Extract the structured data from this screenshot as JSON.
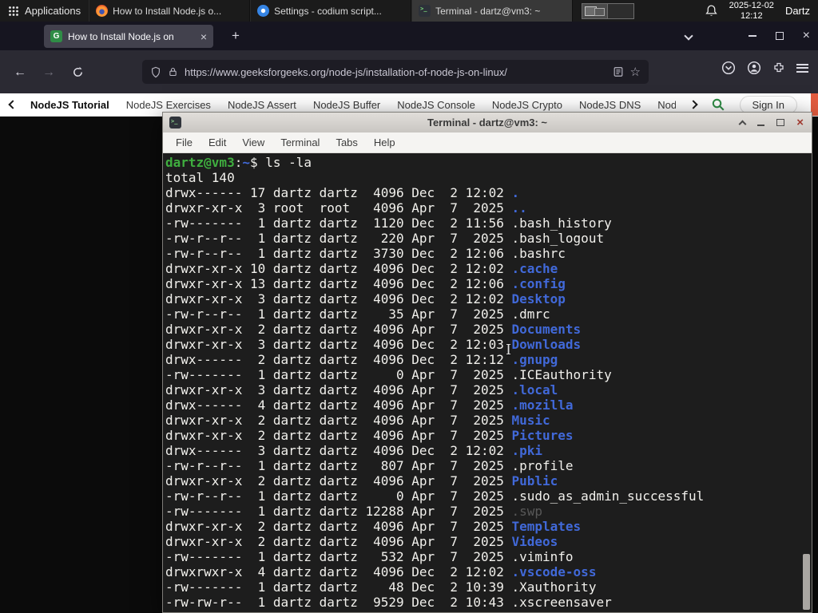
{
  "colors": {
    "gfg_green": "#2f8d46",
    "nav_accent_strip": "#e25c3f",
    "terminal_prompt_green": "#3fae3f",
    "terminal_dir_blue": "#4169d9",
    "terminal_background": "#1d1d1d"
  },
  "panel": {
    "applications_label": "Applications",
    "windows": [
      {
        "title": "How to Install Node.js o...",
        "icon": "firefox",
        "active": false
      },
      {
        "title": "Settings - codium script...",
        "icon": "settings",
        "active": false
      },
      {
        "title": "Terminal - dartz@vm3: ~",
        "icon": "terminal",
        "active": true
      }
    ],
    "clock": {
      "date": "2025-12-02",
      "time": "12:12"
    },
    "user": "Dartz"
  },
  "browser": {
    "tab_title": "How to Install Node.js on",
    "tab_favicon_letter": "G",
    "new_tab_label": "+",
    "url": "https://www.geeksforgeeks.org/node-js/installation-of-node-js-on-linux/",
    "site_nav": {
      "items": [
        "NodeJS Tutorial",
        "NodeJS Exercises",
        "NodeJS Assert",
        "NodeJS Buffer",
        "NodeJS Console",
        "NodeJS Crypto",
        "NodeJS DNS",
        "Node"
      ],
      "sign_in_label": "Sign In"
    }
  },
  "terminal": {
    "title": "Terminal - dartz@vm3: ~",
    "menu": [
      "File",
      "Edit",
      "View",
      "Terminal",
      "Tabs",
      "Help"
    ],
    "prompt_user_host": "dartz@vm3",
    "prompt_separator": ":",
    "prompt_path": "~",
    "prompt_symbol": "$",
    "command": "ls -la",
    "total_line": "total 140",
    "listing": [
      {
        "meta": "drwx------ 17 dartz dartz  4096 Dec  2 12:02 ",
        "name": ".",
        "kind": "dir"
      },
      {
        "meta": "drwxr-xr-x  3 root  root   4096 Apr  7  2025 ",
        "name": "..",
        "kind": "dir"
      },
      {
        "meta": "-rw-------  1 dartz dartz  1120 Dec  2 11:56 ",
        "name": ".bash_history",
        "kind": "file"
      },
      {
        "meta": "-rw-r--r--  1 dartz dartz   220 Apr  7  2025 ",
        "name": ".bash_logout",
        "kind": "file"
      },
      {
        "meta": "-rw-r--r--  1 dartz dartz  3730 Dec  2 12:06 ",
        "name": ".bashrc",
        "kind": "file"
      },
      {
        "meta": "drwxr-xr-x 10 dartz dartz  4096 Dec  2 12:02 ",
        "name": ".cache",
        "kind": "dir"
      },
      {
        "meta": "drwxr-xr-x 13 dartz dartz  4096 Dec  2 12:06 ",
        "name": ".config",
        "kind": "dir"
      },
      {
        "meta": "drwxr-xr-x  3 dartz dartz  4096 Dec  2 12:02 ",
        "name": "Desktop",
        "kind": "dir"
      },
      {
        "meta": "-rw-r--r--  1 dartz dartz    35 Apr  7  2025 ",
        "name": ".dmrc",
        "kind": "file"
      },
      {
        "meta": "drwxr-xr-x  2 dartz dartz  4096 Apr  7  2025 ",
        "name": "Documents",
        "kind": "dir"
      },
      {
        "meta": "drwxr-xr-x  3 dartz dartz  4096 Dec  2 12:03 ",
        "name": "Downloads",
        "kind": "dir"
      },
      {
        "meta": "drwx------  2 dartz dartz  4096 Dec  2 12:12 ",
        "name": ".gnupg",
        "kind": "dir"
      },
      {
        "meta": "-rw-------  1 dartz dartz     0 Apr  7  2025 ",
        "name": ".ICEauthority",
        "kind": "file"
      },
      {
        "meta": "drwxr-xr-x  3 dartz dartz  4096 Apr  7  2025 ",
        "name": ".local",
        "kind": "dir"
      },
      {
        "meta": "drwx------  4 dartz dartz  4096 Apr  7  2025 ",
        "name": ".mozilla",
        "kind": "dir"
      },
      {
        "meta": "drwxr-xr-x  2 dartz dartz  4096 Apr  7  2025 ",
        "name": "Music",
        "kind": "dir"
      },
      {
        "meta": "drwxr-xr-x  2 dartz dartz  4096 Apr  7  2025 ",
        "name": "Pictures",
        "kind": "dir"
      },
      {
        "meta": "drwx------  3 dartz dartz  4096 Dec  2 12:02 ",
        "name": ".pki",
        "kind": "dir"
      },
      {
        "meta": "-rw-r--r--  1 dartz dartz   807 Apr  7  2025 ",
        "name": ".profile",
        "kind": "file"
      },
      {
        "meta": "drwxr-xr-x  2 dartz dartz  4096 Apr  7  2025 ",
        "name": "Public",
        "kind": "dir"
      },
      {
        "meta": "-rw-r--r--  1 dartz dartz     0 Apr  7  2025 ",
        "name": ".sudo_as_admin_successful",
        "kind": "file"
      },
      {
        "meta": "-rw-------  1 dartz dartz 12288 Apr  7  2025 ",
        "name": ".swp",
        "kind": "dim"
      },
      {
        "meta": "drwxr-xr-x  2 dartz dartz  4096 Apr  7  2025 ",
        "name": "Templates",
        "kind": "dir"
      },
      {
        "meta": "drwxr-xr-x  2 dartz dartz  4096 Apr  7  2025 ",
        "name": "Videos",
        "kind": "dir"
      },
      {
        "meta": "-rw-------  1 dartz dartz   532 Apr  7  2025 ",
        "name": ".viminfo",
        "kind": "file"
      },
      {
        "meta": "drwxrwxr-x  4 dartz dartz  4096 Dec  2 12:02 ",
        "name": ".vscode-oss",
        "kind": "dir"
      },
      {
        "meta": "-rw-------  1 dartz dartz    48 Dec  2 10:39 ",
        "name": ".Xauthority",
        "kind": "file"
      },
      {
        "meta": "-rw-rw-r--  1 dartz dartz  9529 Dec  2 10:43 ",
        "name": ".xscreensaver",
        "kind": "file"
      }
    ]
  }
}
